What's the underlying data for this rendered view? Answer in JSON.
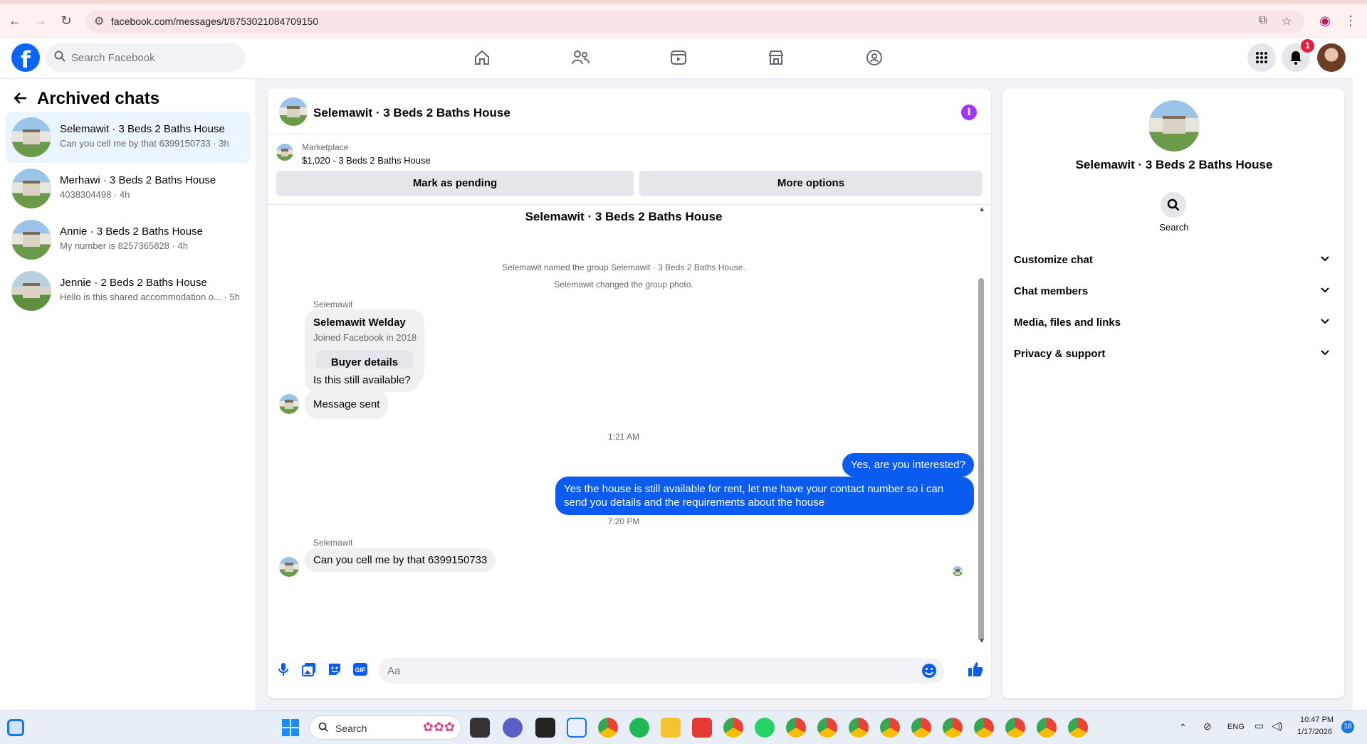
{
  "browser": {
    "url": "facebook.com/messages/t/8753021084709150"
  },
  "fb": {
    "search_placeholder": "Search Facebook",
    "notification_count": "1"
  },
  "sidebar": {
    "title": "Archived chats",
    "chats": [
      {
        "name": "Selemawit · 3 Beds 2 Baths House",
        "preview": "Can you cell me by that 6399150733 · 3h"
      },
      {
        "name": "Merhawi · 3 Beds 2 Baths House",
        "preview": "4038304498 · 4h"
      },
      {
        "name": "Annie · 3 Beds 2 Baths House",
        "preview": "My number is 8257365828 · 4h"
      },
      {
        "name": "Jennie · 2 Beds 2 Baths House",
        "preview": "Hello is this shared accommodation o... · 5h"
      }
    ]
  },
  "chat": {
    "title": "Selemawit · 3 Beds 2 Baths House",
    "marketplace_label": "Marketplace",
    "marketplace_item": "$1,020 - 3 Beds 2 Baths House",
    "mark_pending": "Mark as pending",
    "more_options": "More options",
    "group_title": "Selemawit · 3 Beds 2 Baths House",
    "sys1": "Selemawit named the group Selemawit · 3 Beds 2 Baths House.",
    "sys2": "Selemawit changed the group photo.",
    "sender1": "Selemawit",
    "buyer_name": "Selemawit Welday",
    "buyer_joined": "Joined Facebook in 2018",
    "buyer_details": "Buyer details",
    "msg_available": "Is this still available?",
    "msg_sent": "Message sent",
    "time1": "1:21 AM",
    "out1": "Yes, are you interested?",
    "out2": "Yes the house is still available for rent, let me have your contact number so i can send you details and the requirements about the house",
    "time2": "7:20 PM",
    "sender2": "Selemawit",
    "msg_cell": "Can you cell me by that 6399150733",
    "input_placeholder": "Aa"
  },
  "right_panel": {
    "name": "Selemawit · 3 Beds 2 Baths House",
    "search_label": "Search",
    "rows": [
      "Customize chat",
      "Chat members",
      "Media, files and links",
      "Privacy & support"
    ]
  },
  "taskbar": {
    "search": "Search",
    "lang": "ENG",
    "time": "10:47 PM",
    "date": "1/17/2026",
    "notif": "18"
  }
}
